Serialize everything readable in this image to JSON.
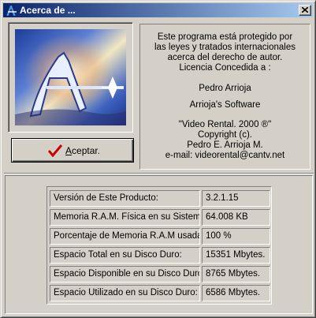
{
  "window": {
    "title": "Acerca de ..."
  },
  "buttons": {
    "accept_label_ul": "A",
    "accept_label_rest": "ceptar."
  },
  "info": {
    "lines": [
      "Este programa está protegido por",
      "las leyes y tratados internacionales",
      "acerca del derecho de autor.",
      "Licencia Concedida a :",
      "Pedro Arrioja",
      "Arrioja's Software",
      "\"Video Rental.  2000 ®\"",
      "Copyright (c).",
      "Pedro E. Arrioja M.",
      "e-mail: videorental@cantv.net"
    ]
  },
  "stats": {
    "rows": [
      {
        "label": "Versión de Este Producto:",
        "value": "3.2.1.15"
      },
      {
        "label": "Memoria R.A.M. Física en su Sistema:",
        "value": "64.008 KB"
      },
      {
        "label": "Porcentaje de Memoria R.A.M usada:",
        "value": "100 %"
      },
      {
        "label": "Espacio Total en su Disco Duro:",
        "value": "15351 Mbytes."
      },
      {
        "label": "Espacio Disponible en su Disco Duro:",
        "value": "8765 Mbytes."
      },
      {
        "label": "Espacio Utilizado en su Disco Duro:",
        "value": "6586 Mbytes."
      }
    ]
  },
  "icons": {
    "app": "star-a-logo-icon",
    "close": "close-x-icon",
    "check": "red-checkmark-icon"
  },
  "colors": {
    "titlebar_start": "#0a246a",
    "titlebar_end": "#a6caf0",
    "face": "#d4d0c8",
    "check": "#cc0000"
  }
}
